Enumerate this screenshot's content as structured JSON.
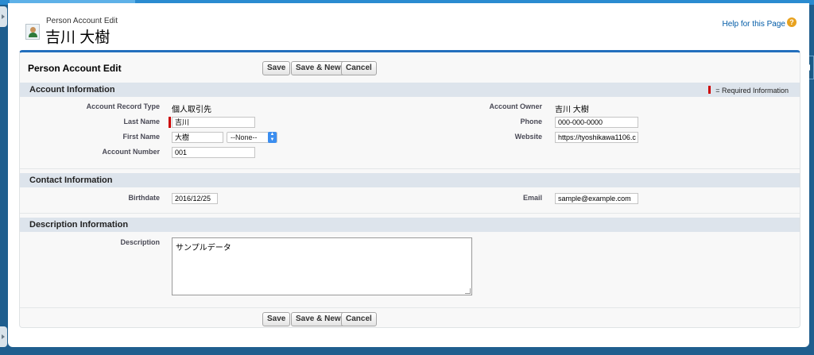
{
  "header": {
    "subtitle": "Person Account Edit",
    "name": "吉川 大樹",
    "help_link": "Help for this Page",
    "help_icon": "?"
  },
  "panel": {
    "title": "Person Account Edit",
    "buttons": {
      "save": "Save",
      "save_new": "Save & New",
      "cancel": "Cancel"
    }
  },
  "required_legend": "= Required Information",
  "sections": {
    "account": {
      "title": "Account Information",
      "record_type_label": "Account Record Type",
      "record_type_value": "個人取引先",
      "last_name_label": "Last Name",
      "last_name_value": "吉川",
      "first_name_label": "First Name",
      "first_name_value": "大樹",
      "salutation_value": "--None--",
      "account_number_label": "Account Number",
      "account_number_value": "001",
      "owner_label": "Account Owner",
      "owner_value": "吉川 大樹",
      "phone_label": "Phone",
      "phone_value": "000-000-0000",
      "website_label": "Website",
      "website_value": "https://tyoshikawa1106.c"
    },
    "contact": {
      "title": "Contact Information",
      "birthdate_label": "Birthdate",
      "birthdate_value": "2016/12/25",
      "email_label": "Email",
      "email_value": "sample@example.com"
    },
    "description": {
      "title": "Description Information",
      "description_label": "Description",
      "description_value": "サンプルデータ"
    }
  },
  "colors": {
    "accent": "#236fbd",
    "required": "#cc0000",
    "section_bg": "#dde4ec"
  }
}
